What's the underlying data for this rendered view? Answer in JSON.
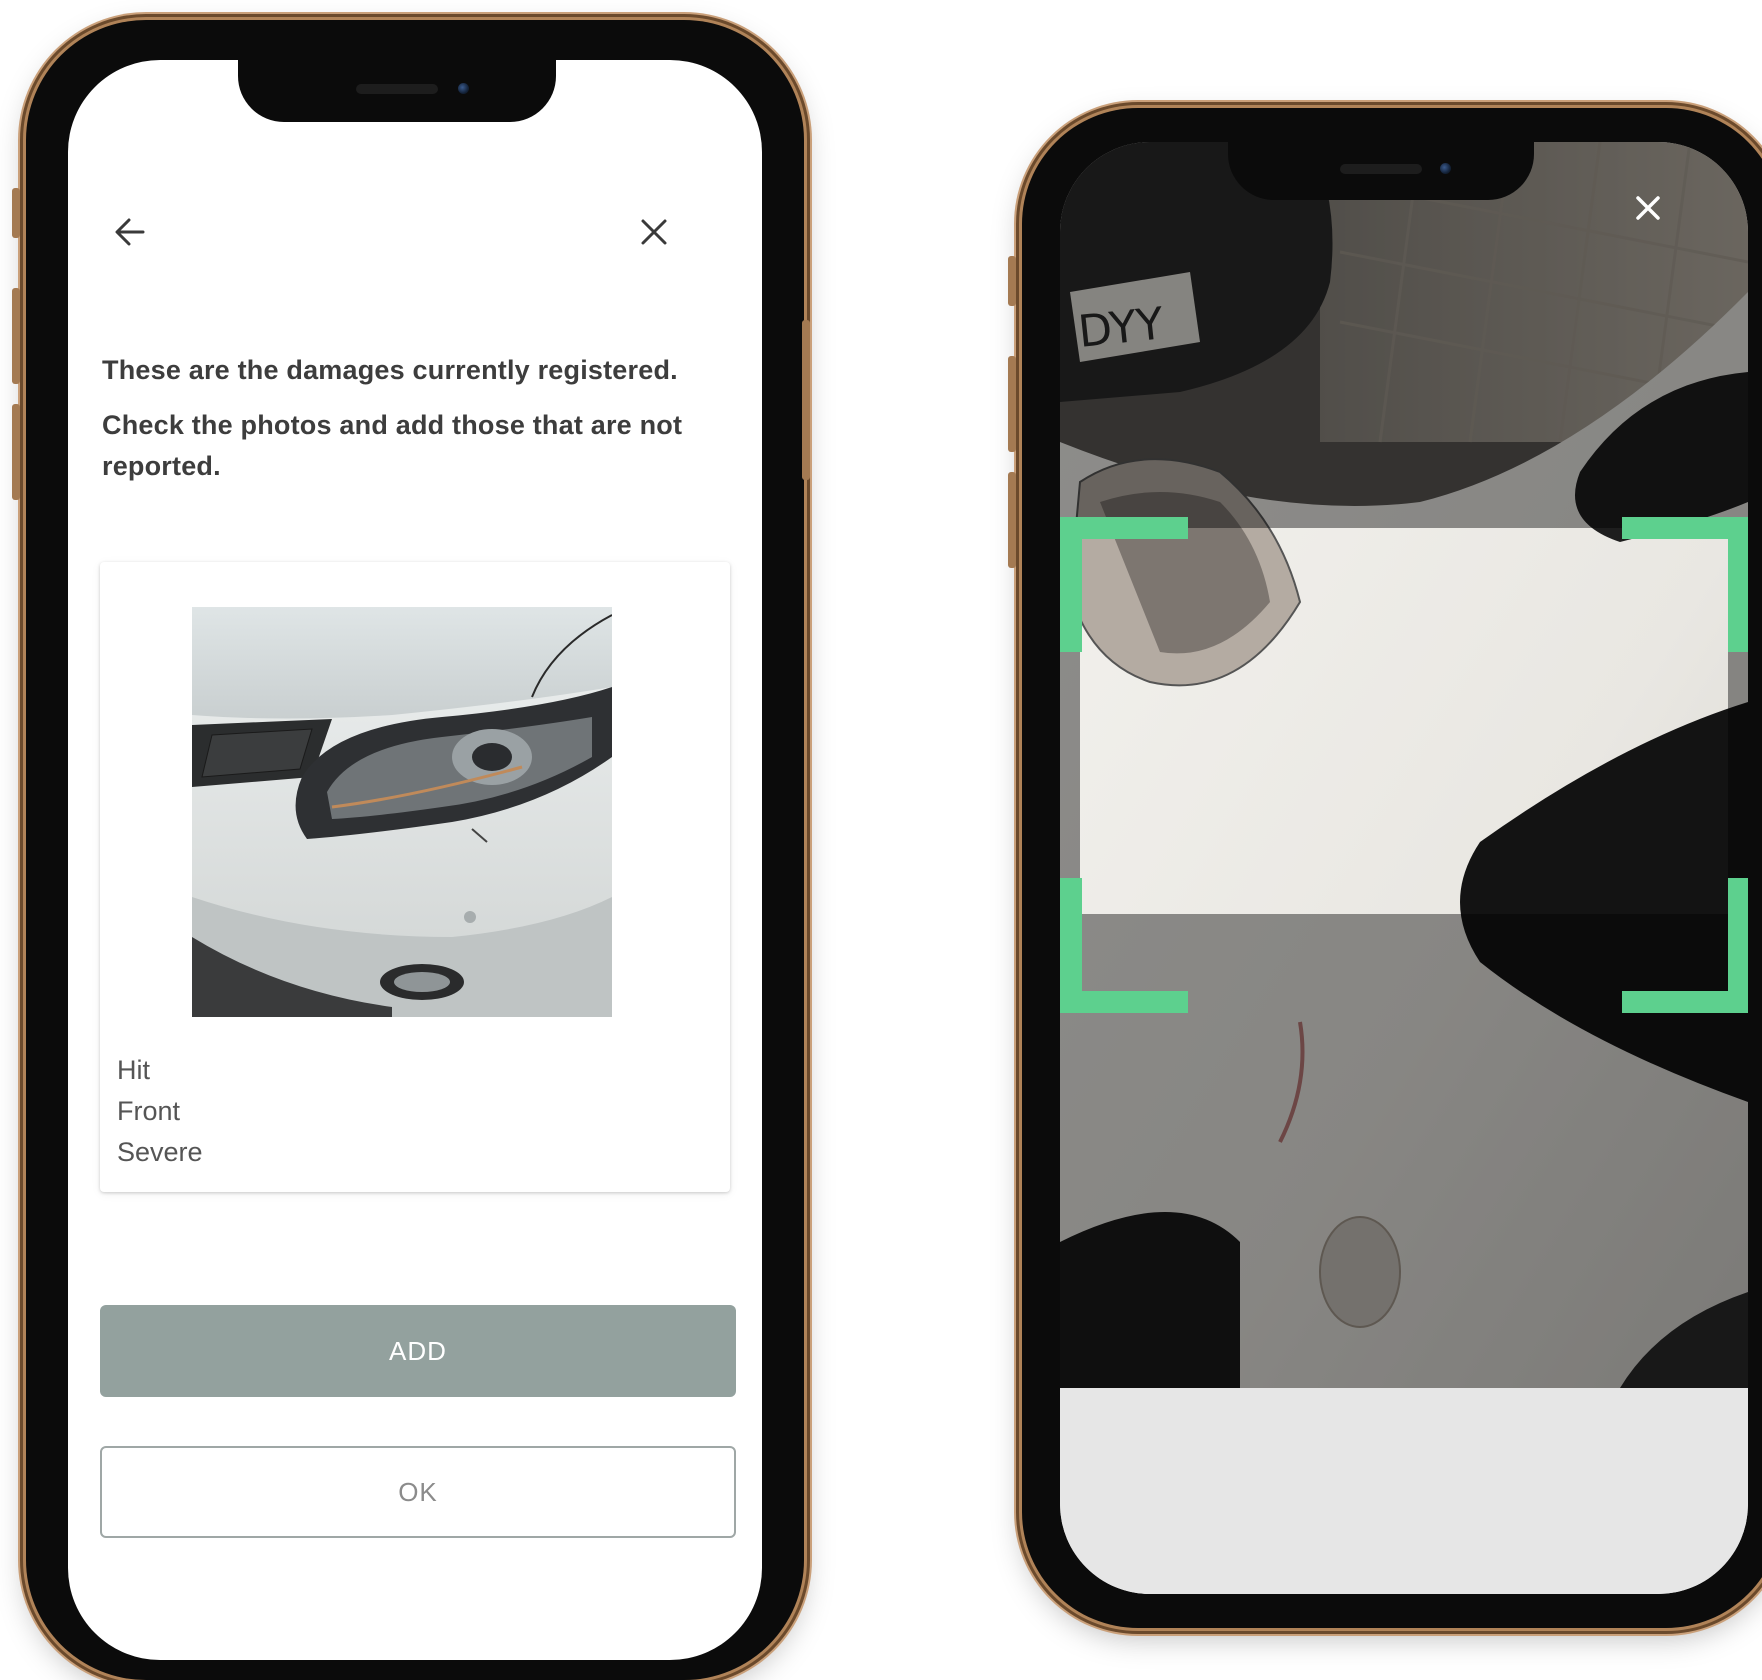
{
  "damages_screen": {
    "intro_line1": "These are the damages currently registered.",
    "intro_line2": "Check the photos and add those that are not reported.",
    "damage": {
      "type": "Hit",
      "location": "Front",
      "severity": "Severe"
    },
    "add_label": "ADD",
    "ok_label": "OK",
    "icons": {
      "back": "arrow-left-icon",
      "close": "close-icon"
    },
    "colors": {
      "primary_button": "#93a19e",
      "text": "#3d3d3d",
      "frame_gold": "#b08358"
    }
  },
  "camera_screen": {
    "plate_text": "DYY",
    "icons": {
      "close": "close-icon"
    },
    "colors": {
      "scan_bracket": "#5dd08e",
      "bottom_bar": "#e6e6e6"
    }
  }
}
